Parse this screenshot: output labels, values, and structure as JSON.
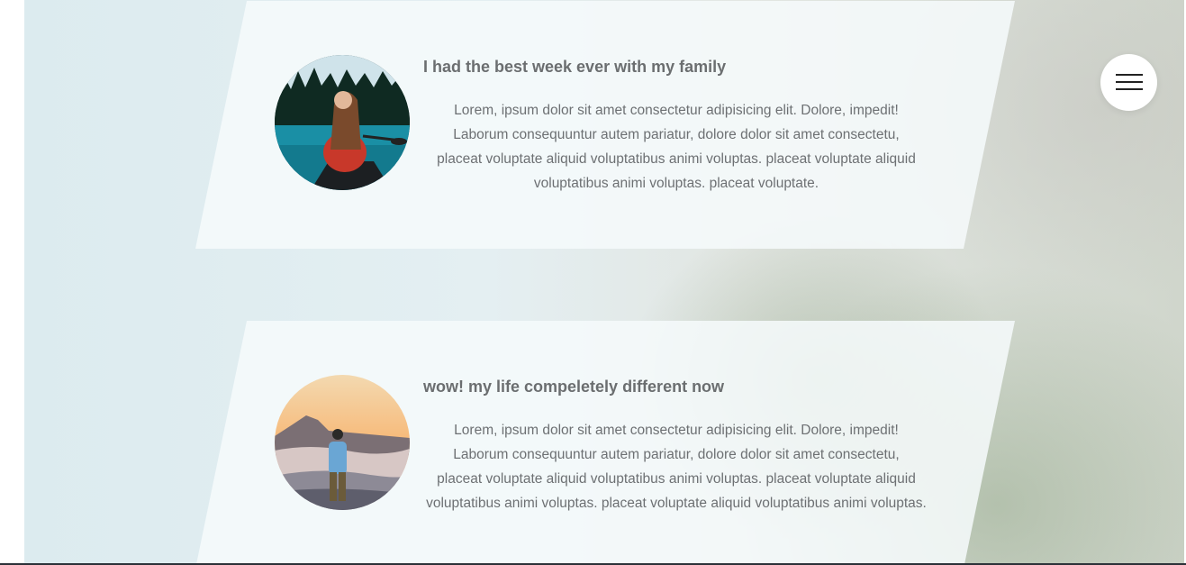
{
  "testimonials": [
    {
      "title": "I had the best week ever with my family",
      "lines": [
        "Lorem, ipsum dolor sit amet consectetur adipisicing elit. Dolore, impedit!",
        "Laborum consequuntur autem pariatur, dolore dolor sit amet consectetu,",
        "placeat voluptate aliquid voluptatibus animi voluptas. placeat voluptate aliquid",
        "voluptatibus animi voluptas. placeat voluptate."
      ],
      "avatar_icon": "woman-in-canoe-photo"
    },
    {
      "title": "wow! my life compeletely different now",
      "lines": [
        "Lorem, ipsum dolor sit amet consectetur adipisicing elit. Dolore, impedit!",
        "Laborum consequuntur autem pariatur, dolore dolor sit amet consectetu,",
        "placeat voluptate aliquid voluptatibus animi voluptas. placeat voluptate aliquid",
        "voluptatibus animi voluptas. placeat voluptate aliquid voluptatibus animi voluptas."
      ],
      "avatar_icon": "man-on-mountain-photo"
    }
  ],
  "menu": {
    "icon": "hamburger-menu-icon"
  },
  "colors": {
    "card_background": "#f6fafb",
    "title_text": "#6b6e70",
    "body_text": "#6d7073",
    "menu_button": "#ffffff",
    "bottom_bar": "#2b3138"
  }
}
